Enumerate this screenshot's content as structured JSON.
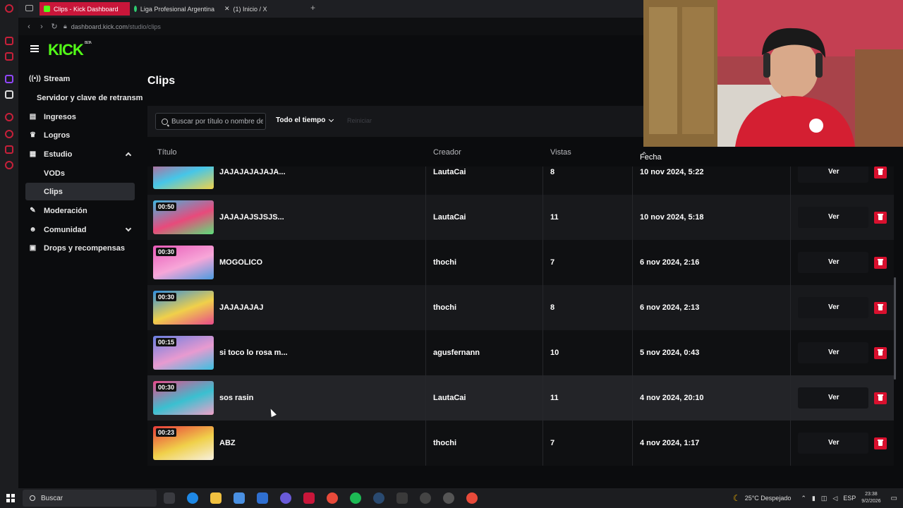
{
  "browser": {
    "tabs": [
      {
        "label": "Clips - Kick Dashboard",
        "active": true,
        "color": "#53fc18"
      },
      {
        "label": "Liga Profesional Argentina",
        "active": false,
        "color": "#2ecc71"
      },
      {
        "label": "(1) Inicio / X",
        "active": false,
        "color": "#ffffff"
      }
    ],
    "new_tab": "+",
    "url_host": "dashboard.kick.com",
    "url_path": "/studio/clips"
  },
  "brand": {
    "logo": "KICK",
    "badge": "BETA",
    "color": "#53fc18"
  },
  "sidebar": {
    "items": [
      {
        "label": "Stream",
        "icon": "broadcast-icon"
      },
      {
        "label": "Servidor y clave de retransm",
        "icon": ""
      },
      {
        "label": "Ingresos",
        "icon": "chart-icon"
      },
      {
        "label": "Logros",
        "icon": "trophy-icon"
      },
      {
        "label": "Estudio",
        "icon": "film-icon"
      },
      {
        "label": "VODs",
        "icon": ""
      },
      {
        "label": "Clips",
        "icon": ""
      },
      {
        "label": "Moderación",
        "icon": "wrench-icon"
      },
      {
        "label": "Comunidad",
        "icon": "users-icon"
      },
      {
        "label": "Drops y recompensas",
        "icon": "gift-icon"
      }
    ]
  },
  "page": {
    "title": "Clips"
  },
  "filters": {
    "search_placeholder": "Buscar por título o nombre de",
    "time_filter": "Todo el tiempo",
    "reset": "Reiniciar"
  },
  "table": {
    "headers": {
      "title": "Título",
      "creator": "Creador",
      "views": "Vistas",
      "date": "Fecha"
    },
    "view_label": "Ver",
    "rows": [
      {
        "duration": "",
        "title": "JAJAJAJAJAJA...",
        "creator": "LautaCai",
        "views": "8",
        "date": "10 nov 2024, 5:22",
        "thumb": [
          "#e8437a",
          "#46c6e8",
          "#f0d24a"
        ]
      },
      {
        "duration": "00:50",
        "title": "JAJAJAJSJSJS...",
        "creator": "LautaCai",
        "views": "11",
        "date": "10 nov 2024, 5:18",
        "thumb": [
          "#3fb6e0",
          "#e84a7b",
          "#5ce07a"
        ]
      },
      {
        "duration": "00:30",
        "title": "MOGOLICO",
        "creator": "thochi",
        "views": "7",
        "date": "6 nov 2024, 2:16",
        "thumb": [
          "#e85ab8",
          "#f7a6d8",
          "#4a9be0"
        ]
      },
      {
        "duration": "00:30",
        "title": "JAJAJAJAJ",
        "creator": "thochi",
        "views": "8",
        "date": "6 nov 2024, 2:13",
        "thumb": [
          "#2f8ee0",
          "#f0d04a",
          "#e84a8a"
        ]
      },
      {
        "duration": "00:15",
        "title": "si toco lo rosa m...",
        "creator": "agusfernann",
        "views": "10",
        "date": "5 nov 2024, 0:43",
        "thumb": [
          "#6a7ee0",
          "#e89ad0",
          "#3ac0e0"
        ]
      },
      {
        "duration": "00:30",
        "title": "sos rasin",
        "creator": "LautaCai",
        "views": "11",
        "date": "4 nov 2024, 20:10",
        "thumb": [
          "#e84a8a",
          "#3ac0d0",
          "#f0a0c8"
        ]
      },
      {
        "duration": "00:23",
        "title": "ABZ",
        "creator": "thochi",
        "views": "7",
        "date": "4 nov 2024, 1:17",
        "thumb": [
          "#e83a3a",
          "#f0d04a",
          "#f7f0e0"
        ]
      }
    ]
  },
  "taskbar": {
    "search": "Buscar",
    "weather": "25°C  Despejado",
    "lang": "ESP",
    "time": "23:38",
    "date": "9/2/2026"
  }
}
